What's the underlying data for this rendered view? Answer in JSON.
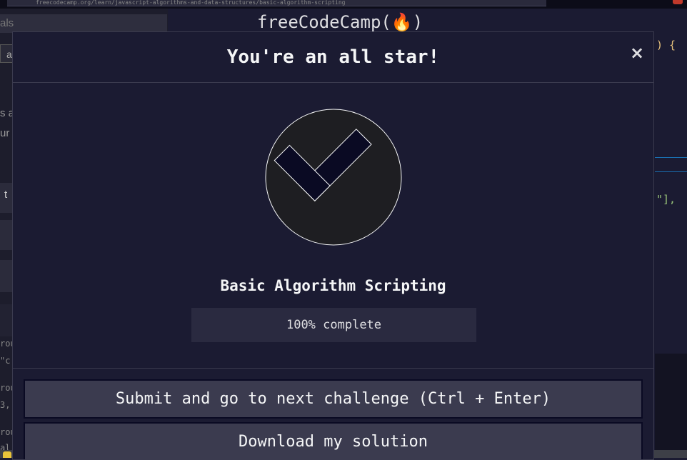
{
  "browser": {
    "url_fragment": "freecodecamp.org/learn/javascript-algorithms-and-data-structures/basic-algorithm-scripting"
  },
  "background": {
    "left_tab_label": "als",
    "left_input_text": "a",
    "left_text_lines": [
      "s a",
      "ur",
      "t"
    ],
    "left_code_lines": [
      "rou",
      "\"c",
      "rou",
      "3,",
      "rou",
      "al"
    ],
    "editor_title": "freeCodeCamp(🔥)",
    "editor_code": [
      ") {",
      "\"],"
    ]
  },
  "modal": {
    "title": "You're an all star!",
    "close_symbol": "×",
    "check_icon": "checkmark-icon",
    "cert_title": "Basic Algorithm Scripting",
    "progress": {
      "percent": 100,
      "label": "100% complete"
    },
    "buttons": {
      "submit": "Submit and go to next challenge (Ctrl + Enter)",
      "download": "Download my solution"
    }
  },
  "colors": {
    "background": "#1b1b32",
    "text": "#f5f6f7",
    "button": "#3b3b4f",
    "check_fill": "#0a0a23"
  }
}
